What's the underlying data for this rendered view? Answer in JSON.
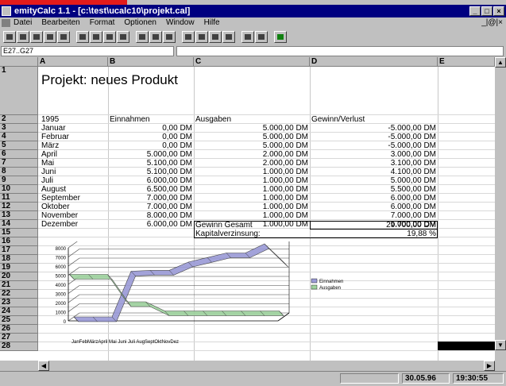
{
  "window": {
    "title": "emityCalc 1.1 - [c:\\test\\ucalc10\\projekt.cal]",
    "controls": {
      "min": "_",
      "max": "□",
      "close": "×"
    },
    "mdi_controls": "_|@|×"
  },
  "menu": [
    "Datei",
    "Bearbeiten",
    "Format",
    "Optionen",
    "Window",
    "Hilfe"
  ],
  "formula": {
    "cell_ref": "E27..G27",
    "content": ""
  },
  "columns": [
    "A",
    "B",
    "C",
    "D",
    "E"
  ],
  "rows": [
    "1",
    "2",
    "3",
    "4",
    "5",
    "6",
    "7",
    "8",
    "9",
    "10",
    "11",
    "12",
    "13",
    "14",
    "15",
    "16",
    "17",
    "18",
    "19",
    "20",
    "21",
    "22",
    "23",
    "24",
    "25",
    "26",
    "27",
    "28"
  ],
  "sheet": {
    "title": "Projekt: neues Produkt",
    "headers": {
      "year": "1995",
      "income": "Einnahmen",
      "expenses": "Ausgaben",
      "profit": "Gewinn/Verlust"
    },
    "months": [
      {
        "name": "Januar",
        "income": "0,00 DM",
        "expenses": "5.000,00 DM",
        "profit": "-5.000,00 DM"
      },
      {
        "name": "Februar",
        "income": "0,00 DM",
        "expenses": "5.000,00 DM",
        "profit": "-5.000,00 DM"
      },
      {
        "name": "März",
        "income": "0,00 DM",
        "expenses": "5.000,00 DM",
        "profit": "-5.000,00 DM"
      },
      {
        "name": "April",
        "income": "5.000,00 DM",
        "expenses": "2.000,00 DM",
        "profit": "3.000,00 DM"
      },
      {
        "name": "Mai",
        "income": "5.100,00 DM",
        "expenses": "2.000,00 DM",
        "profit": "3.100,00 DM"
      },
      {
        "name": "Juni",
        "income": "5.100,00 DM",
        "expenses": "1.000,00 DM",
        "profit": "4.100,00 DM"
      },
      {
        "name": "Juli",
        "income": "6.000,00 DM",
        "expenses": "1.000,00 DM",
        "profit": "5.000,00 DM"
      },
      {
        "name": "August",
        "income": "6.500,00 DM",
        "expenses": "1.000,00 DM",
        "profit": "5.500,00 DM"
      },
      {
        "name": "September",
        "income": "7.000,00 DM",
        "expenses": "1.000,00 DM",
        "profit": "6.000,00 DM"
      },
      {
        "name": "Oktober",
        "income": "7.000,00 DM",
        "expenses": "1.000,00 DM",
        "profit": "6.000,00 DM"
      },
      {
        "name": "November",
        "income": "8.000,00 DM",
        "expenses": "1.000,00 DM",
        "profit": "7.000,00 DM"
      },
      {
        "name": "Dezember",
        "income": "6.000,00 DM",
        "expenses": "1.000,00 DM",
        "profit": "5.000,00 DM"
      }
    ],
    "total_label": "Gewinn Gesamt",
    "total_value": "29.700,00 DM",
    "interest_label": "Kapitalverzinsung:",
    "interest_value": "19,88 %"
  },
  "chart_data": {
    "type": "area",
    "categories": [
      "Jan",
      "Feb",
      "März",
      "April",
      "Mai",
      "Juni",
      "Juli",
      "Aug",
      "Sept",
      "Okt",
      "Nov",
      "Dez"
    ],
    "tick_labels": "JanFebMärzApril Mai Juni Juli AugSeptOktNovDez",
    "series": [
      {
        "name": "Einnahmen",
        "values": [
          0,
          0,
          0,
          5000,
          5100,
          5100,
          6000,
          6500,
          7000,
          7000,
          8000,
          6000
        ]
      },
      {
        "name": "Ausgaben",
        "values": [
          5000,
          5000,
          5000,
          2000,
          2000,
          1000,
          1000,
          1000,
          1000,
          1000,
          1000,
          1000
        ]
      }
    ],
    "yticks": [
      "8000",
      "7000",
      "6000",
      "5000",
      "4000",
      "3000",
      "2000",
      "1000",
      "0"
    ],
    "ylim": [
      0,
      8000
    ],
    "legend": "right",
    "colors": {
      "Einnahmen": "#9a9ad6",
      "Ausgaben": "#9ed29e"
    }
  },
  "status": {
    "field1": "",
    "date": "30.05.96",
    "time": "19:30:55"
  }
}
